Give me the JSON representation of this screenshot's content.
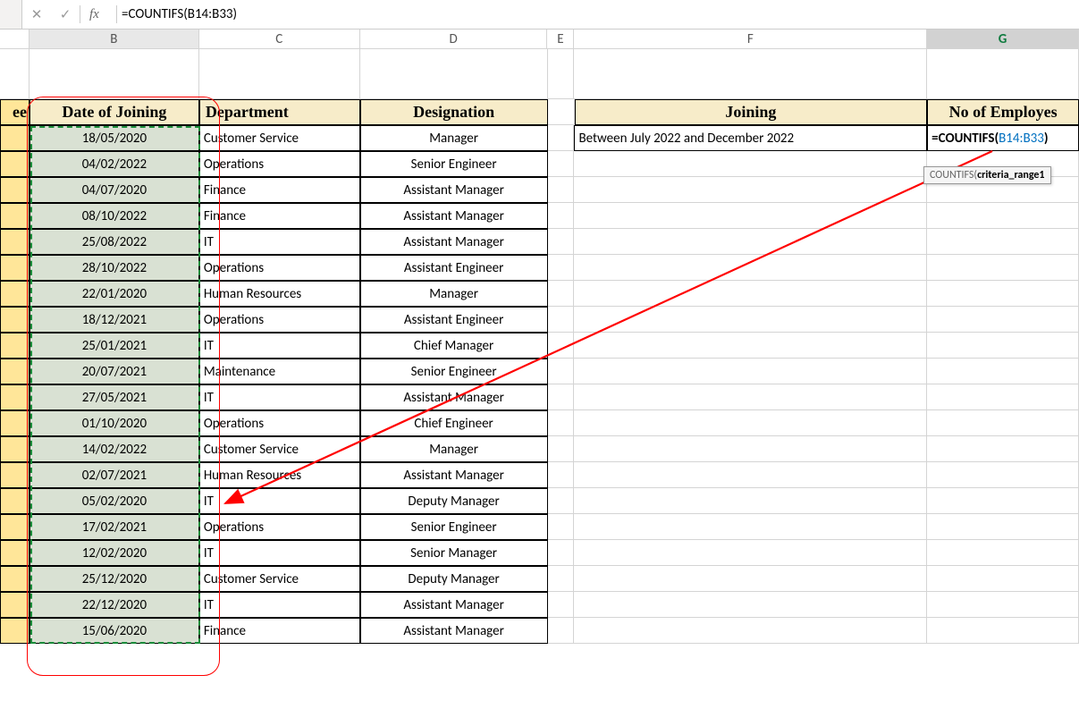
{
  "formula_bar": {
    "cancel": "✕",
    "check": "✓",
    "fx": "fx",
    "formula": "=COUNTIFS(B14:B33)"
  },
  "cols": {
    "corner": "",
    "A": "",
    "B": "B",
    "C": "C",
    "D": "D",
    "E": "E",
    "F": "F",
    "G": "G"
  },
  "headers": {
    "A": "ee",
    "B": "Date of Joining",
    "C": "Department",
    "D": "Designation",
    "F": "Joining",
    "G": "No of Employes"
  },
  "table": [
    {
      "date": "18/05/2020",
      "dept": "Customer Service",
      "desig": "Manager"
    },
    {
      "date": "04/02/2022",
      "dept": "Operations",
      "desig": "Senior Engineer"
    },
    {
      "date": "04/07/2020",
      "dept": "Finance",
      "desig": "Assistant Manager"
    },
    {
      "date": "08/10/2022",
      "dept": "Finance",
      "desig": "Assistant Manager"
    },
    {
      "date": "25/08/2022",
      "dept": "IT",
      "desig": "Assistant Manager"
    },
    {
      "date": "28/10/2022",
      "dept": "Operations",
      "desig": "Assistant Engineer"
    },
    {
      "date": "22/01/2020",
      "dept": "Human Resources",
      "desig": "Manager"
    },
    {
      "date": "18/12/2021",
      "dept": "Operations",
      "desig": "Assistant Engineer"
    },
    {
      "date": "25/01/2021",
      "dept": "IT",
      "desig": "Chief Manager"
    },
    {
      "date": "20/07/2021",
      "dept": "Maintenance",
      "desig": "Senior Engineer"
    },
    {
      "date": "27/05/2021",
      "dept": "IT",
      "desig": "Assistant Manager"
    },
    {
      "date": "01/10/2020",
      "dept": "Operations",
      "desig": "Chief Engineer"
    },
    {
      "date": "14/02/2022",
      "dept": "Customer Service",
      "desig": "Manager"
    },
    {
      "date": "02/07/2021",
      "dept": "Human Resources",
      "desig": "Assistant Manager"
    },
    {
      "date": "05/02/2020",
      "dept": "IT",
      "desig": "Deputy Manager"
    },
    {
      "date": "17/02/2021",
      "dept": "Operations",
      "desig": "Senior Engineer"
    },
    {
      "date": "12/02/2020",
      "dept": "IT",
      "desig": "Senior Manager"
    },
    {
      "date": "25/12/2020",
      "dept": "Customer Service",
      "desig": "Deputy Manager"
    },
    {
      "date": "22/12/2020",
      "dept": "IT",
      "desig": "Assistant Manager"
    },
    {
      "date": "15/06/2020",
      "dept": "Finance",
      "desig": "Assistant Manager"
    }
  ],
  "right": {
    "joining": "Between July 2022 and December 2022",
    "formula_prefix": "=COUNTIFS(",
    "formula_ref": "B14:B33",
    "formula_suffix": ")"
  },
  "tooltip": {
    "fn": "COUNTIFS(",
    "arg": "criteria_range1"
  },
  "widths": {
    "corner": 0,
    "A": 33,
    "B": 190,
    "C": 180,
    "D": 210,
    "E": 30,
    "F": 395,
    "G": 170
  }
}
